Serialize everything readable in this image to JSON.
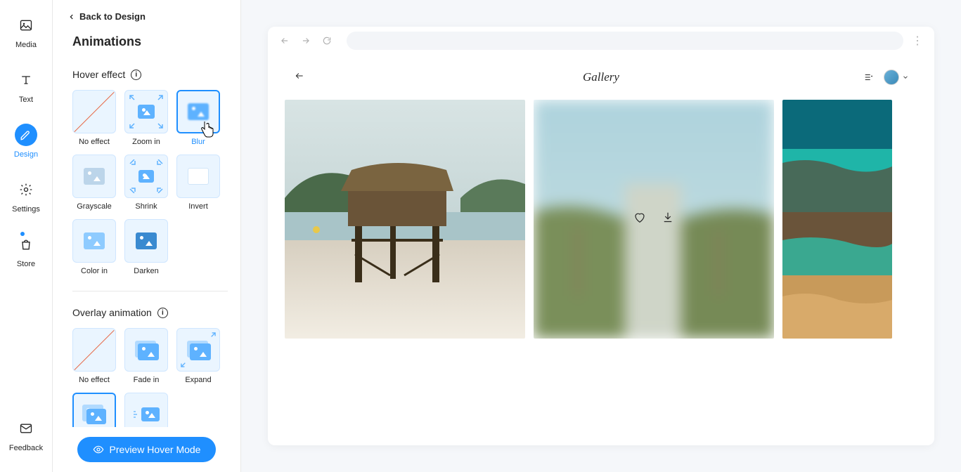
{
  "nav": {
    "items": [
      {
        "label": "Media",
        "icon": "media-icon"
      },
      {
        "label": "Text",
        "icon": "text-icon"
      },
      {
        "label": "Design",
        "icon": "design-icon",
        "active": true
      },
      {
        "label": "Settings",
        "icon": "settings-icon"
      },
      {
        "label": "Store",
        "icon": "store-icon",
        "badge": true
      }
    ],
    "feedback": {
      "label": "Feedback",
      "icon": "feedback-icon"
    }
  },
  "panel": {
    "back_label": "Back to Design",
    "title": "Animations",
    "hover_section": "Hover effect",
    "overlay_section": "Overlay animation",
    "hover_effects": [
      {
        "label": "No effect",
        "kind": "noeffect"
      },
      {
        "label": "Zoom in",
        "kind": "zoom-in"
      },
      {
        "label": "Blur",
        "kind": "blur",
        "selected": true
      },
      {
        "label": "Grayscale",
        "kind": "grayscale"
      },
      {
        "label": "Shrink",
        "kind": "shrink"
      },
      {
        "label": "Invert",
        "kind": "invert"
      },
      {
        "label": "Color in",
        "kind": "color-in"
      },
      {
        "label": "Darken",
        "kind": "darken"
      }
    ],
    "overlay_effects": [
      {
        "label": "No effect",
        "kind": "noeffect"
      },
      {
        "label": "Fade in",
        "kind": "fade-in"
      },
      {
        "label": "Expand",
        "kind": "expand"
      },
      {
        "label": "",
        "kind": "pop",
        "selected": true
      },
      {
        "label": "",
        "kind": "slide"
      }
    ],
    "preview_btn": "Preview Hover Mode"
  },
  "preview": {
    "page_title": "Gallery"
  }
}
